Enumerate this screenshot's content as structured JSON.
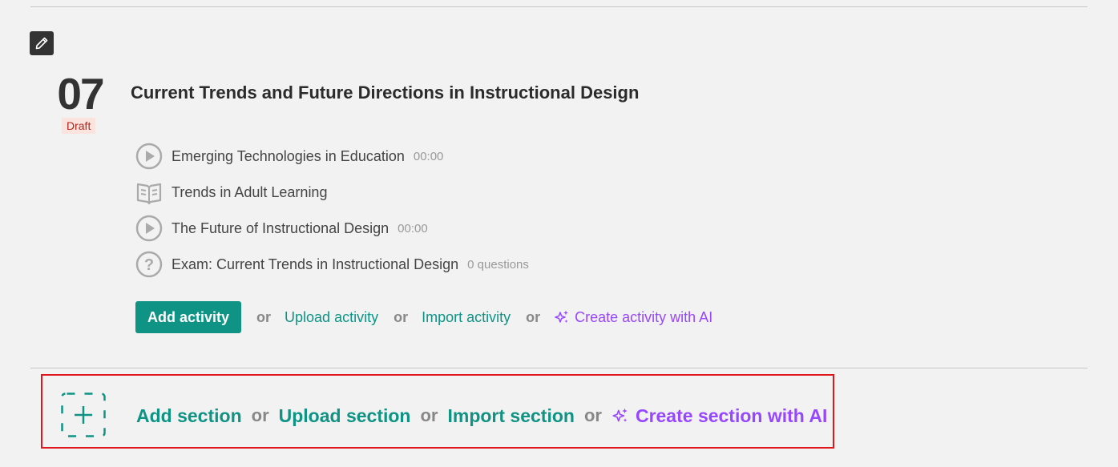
{
  "section": {
    "number": "07",
    "status": "Draft",
    "title": "Current Trends and Future Directions in Instructional Design"
  },
  "activities": [
    {
      "icon": "play-circle-icon",
      "name": "Emerging Technologies in Education",
      "meta": "00:00"
    },
    {
      "icon": "book-icon",
      "name": "Trends in Adult Learning",
      "meta": ""
    },
    {
      "icon": "play-circle-icon",
      "name": "The Future of Instructional Design",
      "meta": "00:00"
    },
    {
      "icon": "question-circle-icon",
      "name": "Exam: Current Trends in Instructional Design",
      "meta": "0 questions"
    }
  ],
  "activity_actions": {
    "add": "Add activity",
    "or": "or",
    "upload": "Upload activity",
    "import": "Import activity",
    "ai": "Create activity with AI"
  },
  "section_actions": {
    "add": "Add section",
    "or": "or",
    "upload": "Upload section",
    "import": "Import section",
    "ai": "Create section with AI"
  },
  "colors": {
    "accent": "#0e9384",
    "ai": "#9747ff",
    "draft_bg": "#fbe3de",
    "draft_text": "#b3261e",
    "highlight_border": "#e0161c"
  }
}
